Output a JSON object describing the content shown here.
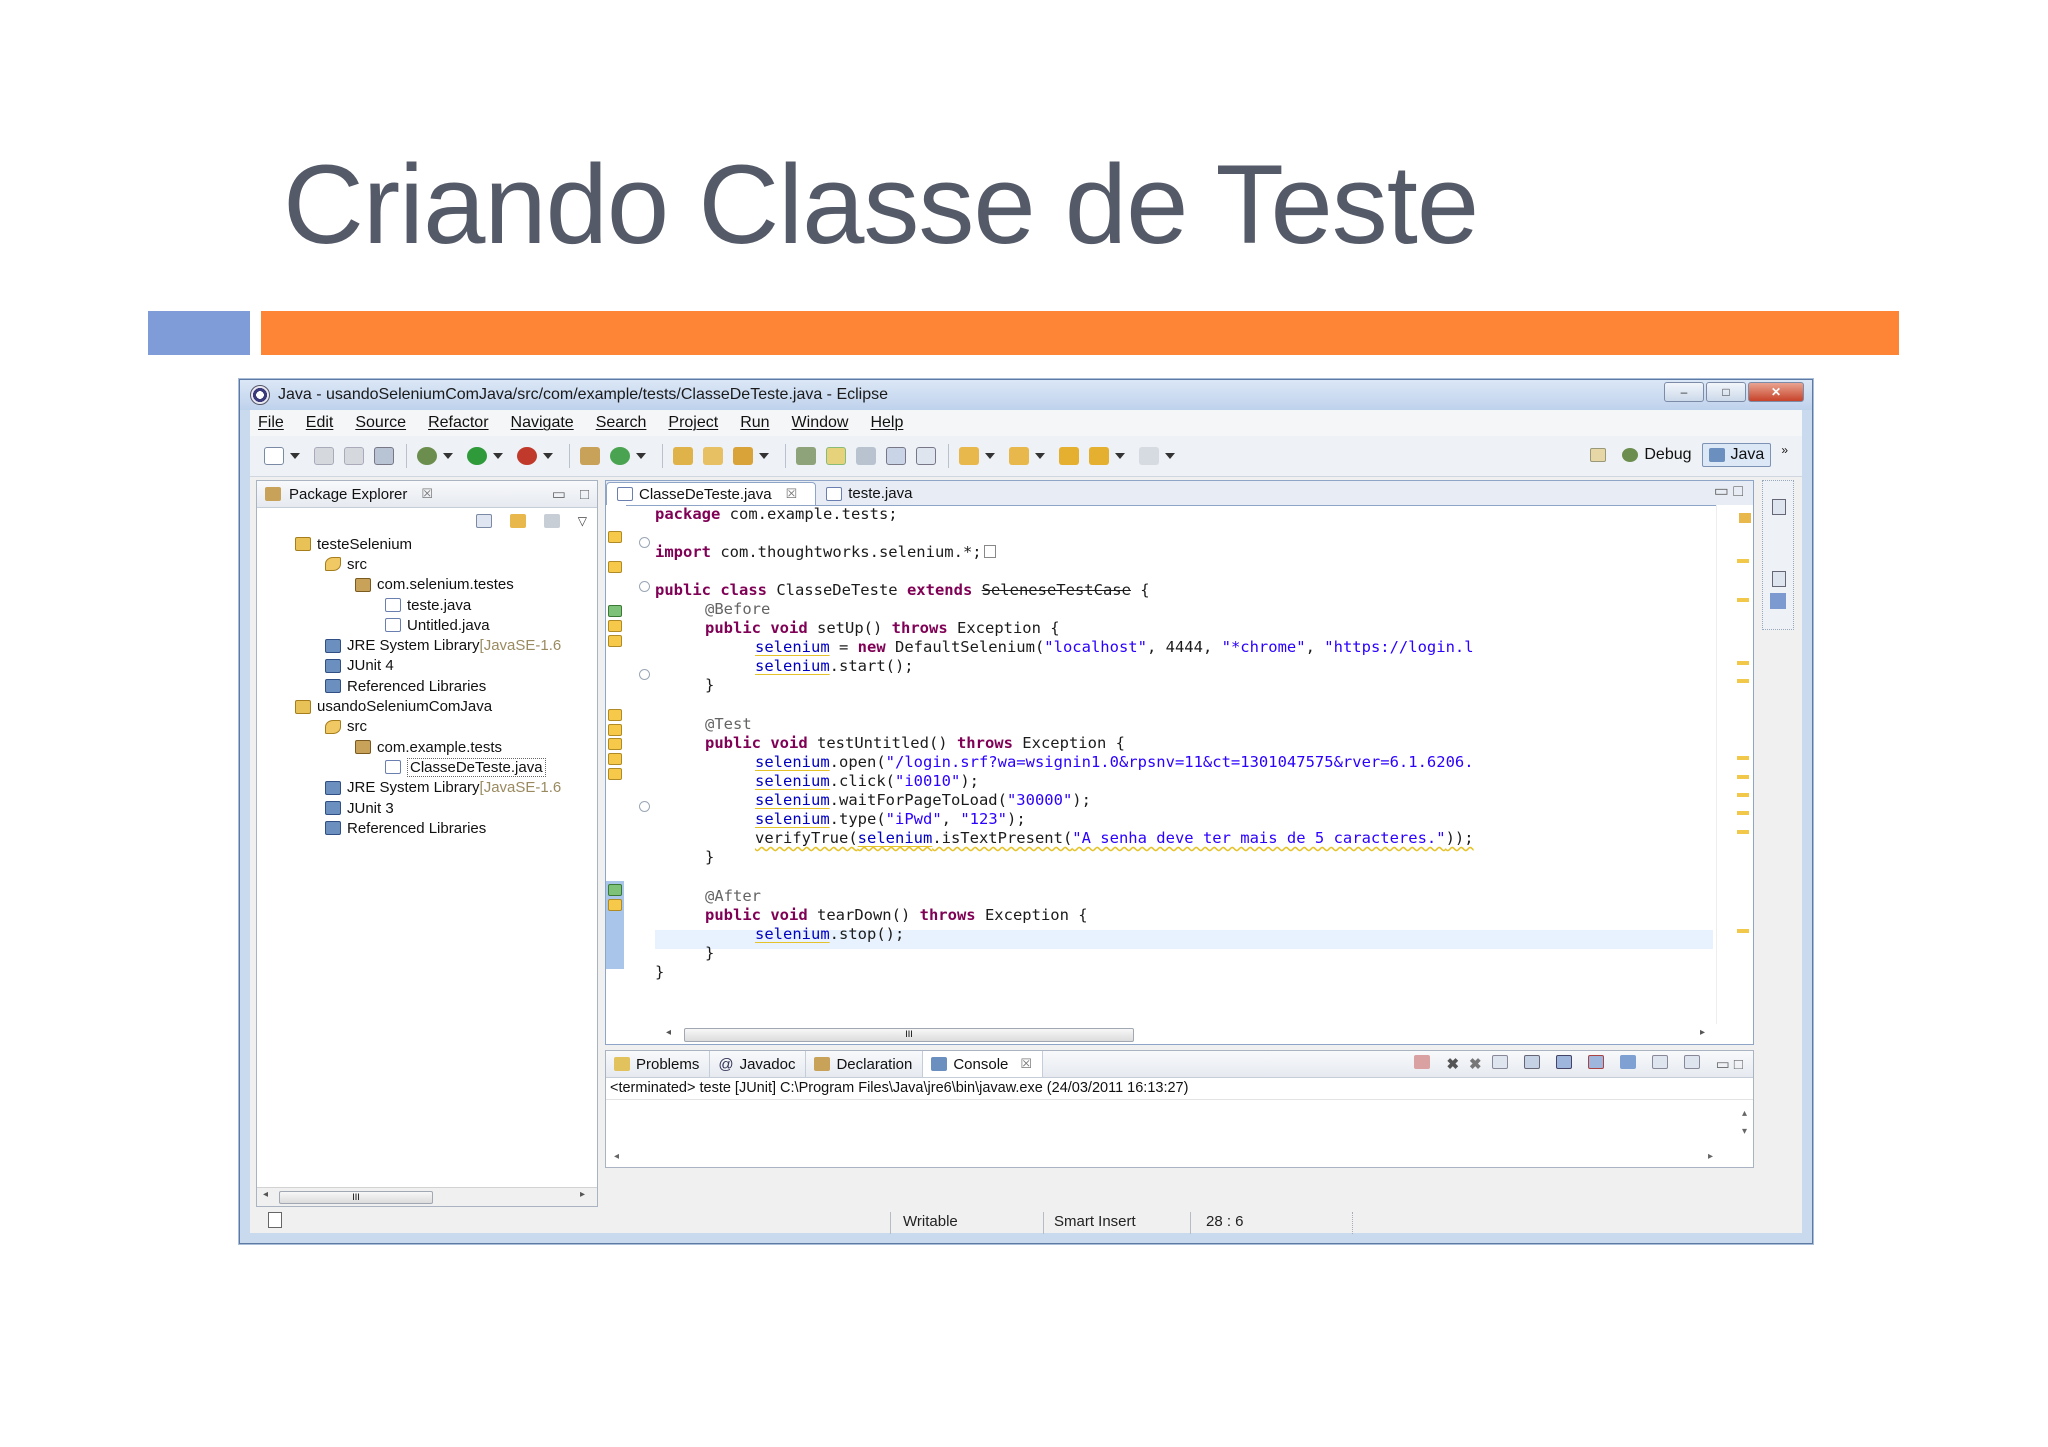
{
  "slide": {
    "title": "Criando Classe de Teste"
  },
  "window": {
    "title": "Java - usandoSeleniumComJava/src/com/example/tests/ClasseDeTeste.java - Eclipse",
    "controls": {
      "minimize": "–",
      "maximize": "□",
      "close": "✕"
    }
  },
  "menu": [
    "File",
    "Edit",
    "Source",
    "Refactor",
    "Navigate",
    "Search",
    "Project",
    "Run",
    "Window",
    "Help"
  ],
  "perspectives": {
    "debug": "Debug",
    "java": "Java",
    "more": "»"
  },
  "package_explorer": {
    "title": "Package Explorer",
    "tree": [
      {
        "label": "testeSelenium",
        "suffix": "",
        "type": "proj",
        "indent": 0
      },
      {
        "label": "src",
        "suffix": "",
        "type": "src",
        "indent": 1
      },
      {
        "label": "com.selenium.testes",
        "suffix": "",
        "type": "pkg",
        "indent": 2
      },
      {
        "label": "teste.java",
        "suffix": "",
        "type": "java",
        "indent": 3
      },
      {
        "label": "Untitled.java",
        "suffix": "",
        "type": "java",
        "indent": 3
      },
      {
        "label": "JRE System Library ",
        "suffix": "[JavaSE-1.6",
        "type": "lib",
        "indent": 1
      },
      {
        "label": "JUnit 4",
        "suffix": "",
        "type": "lib",
        "indent": 1
      },
      {
        "label": "Referenced Libraries",
        "suffix": "",
        "type": "lib",
        "indent": 1
      },
      {
        "label": "usandoSeleniumComJava",
        "suffix": "",
        "type": "proj",
        "indent": 0
      },
      {
        "label": "src",
        "suffix": "",
        "type": "src",
        "indent": 1
      },
      {
        "label": "com.example.tests",
        "suffix": "",
        "type": "pkg",
        "indent": 2
      },
      {
        "label": "ClasseDeTeste.java",
        "suffix": "",
        "type": "java",
        "indent": 3
      },
      {
        "label": "JRE System Library ",
        "suffix": "[JavaSE-1.6",
        "type": "lib",
        "indent": 1
      },
      {
        "label": "JUnit 3",
        "suffix": "",
        "type": "lib",
        "indent": 1
      },
      {
        "label": "Referenced Libraries",
        "suffix": "",
        "type": "lib",
        "indent": 1
      }
    ]
  },
  "editor": {
    "tabs": [
      {
        "label": "ClasseDeTeste.java",
        "active": true
      },
      {
        "label": "teste.java",
        "active": false
      }
    ],
    "code": {
      "l1": {
        "kw": "package",
        "rest": " com.example.tests;"
      },
      "l2": {
        "kw": "import",
        "rest": " com.thoughtworks.selenium.*;"
      },
      "l3": {
        "kw1": "public class",
        "mid": " ClasseDeTeste ",
        "kw2": "extends",
        "dep": "SeleneseTestCase",
        "rest": " {"
      },
      "l4": "@Before",
      "l5": {
        "kw1": "public void",
        "mid": " setUp() ",
        "kw2": "throws",
        "rest": " Exception {"
      },
      "l6": {
        "fld": "selenium",
        "a": " = ",
        "kw": "new",
        "b": " DefaultSelenium(",
        "s1": "\"localhost\"",
        "c": ", 4444, ",
        "s2": "\"*chrome\"",
        "d": ", ",
        "s3": "\"https://login.l"
      },
      "l7": {
        "fld": "selenium",
        "rest": ".start();"
      },
      "l8": "}",
      "l9": "@Test",
      "l10": {
        "kw1": "public void",
        "mid": " testUntitled() ",
        "kw2": "throws",
        "rest": " Exception {"
      },
      "l11": {
        "fld": "selenium",
        "a": ".open(",
        "s": "\"/login.srf?wa=wsignin1.0&rpsnv=11&ct=1301047575&rver=6.1.6206."
      },
      "l12": {
        "fld": "selenium",
        "a": ".click(",
        "s": "\"i0010\"",
        "b": ");"
      },
      "l13": {
        "fld": "selenium",
        "a": ".waitForPageToLoad(",
        "s": "\"30000\"",
        "b": ");"
      },
      "l14": {
        "fld": "selenium",
        "a": ".type(",
        "s1": "\"iPwd\"",
        "c": ", ",
        "s2": "\"123\"",
        "b": ");"
      },
      "l15": {
        "a": "verifyTrue(",
        "fld": "selenium",
        "b": ".isTextPresent(",
        "s": "\"A senha deve ter mais de 5 caracteres.\"",
        "c": "));"
      },
      "l16": "}",
      "l17": "@After",
      "l18": {
        "kw1": "public void",
        "mid": " tearDown() ",
        "kw2": "throws",
        "rest": " Exception {"
      },
      "l19": {
        "fld": "selenium",
        "rest": ".stop();"
      },
      "l20": "}",
      "l21": "}"
    },
    "hscroll_grip": "III"
  },
  "console_view": {
    "tabs": [
      "Problems",
      "Javadoc",
      "Declaration",
      "Console"
    ],
    "active_tab": "Console",
    "output": "<terminated> teste [JUnit] C:\\Program Files\\Java\\jre6\\bin\\javaw.exe (24/03/2011 16:13:27)"
  },
  "status": {
    "writable": "Writable",
    "insert_mode": "Smart Insert",
    "position": "28 : 6"
  },
  "colors": {
    "keyword": "#7f0055",
    "string": "#2a00ff",
    "field": "#0000c0",
    "accent_orange": "#fd8535",
    "accent_blue": "#7f9bd8"
  }
}
